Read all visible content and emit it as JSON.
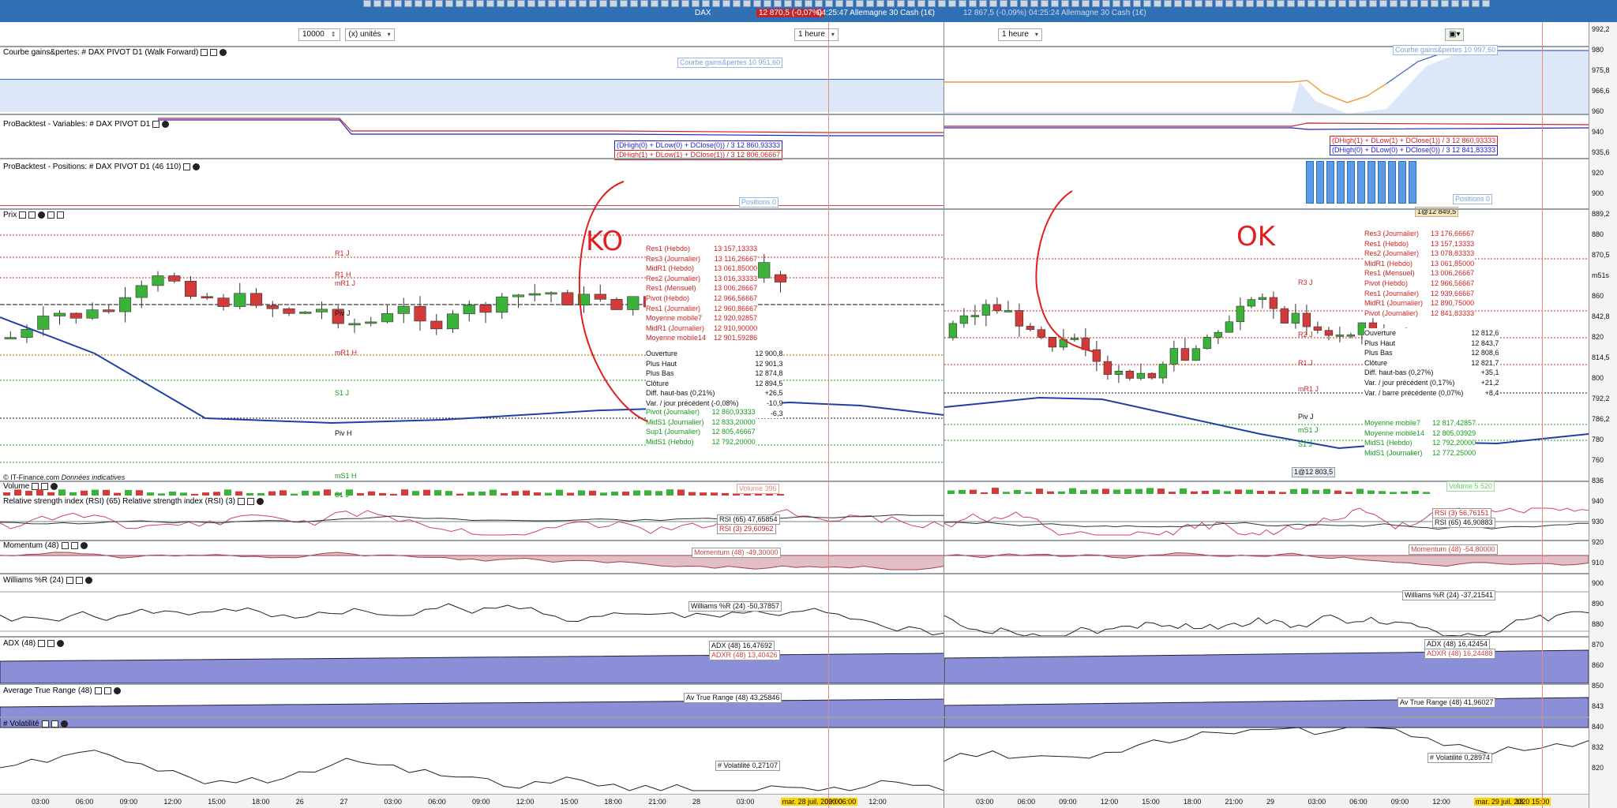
{
  "topbar": {
    "symbol": "DAX",
    "price_badge": "12 870,5 (-0,07%)",
    "time": "04:25:47 Allemagne 30 Cash (1€)",
    "right_info": "12 867,5 (-0,09%) 04:25:24 Allemagne 30 Cash (1€)"
  },
  "left": {
    "quantity": "10000",
    "units": "(x) unités",
    "timeframe": "1 heure",
    "titles": {
      "equity": "Courbe gains&pertes: # DAX PIVOT D1 (Walk Forward)",
      "vars": "ProBacktest - Variables: # DAX PIVOT D1",
      "positions": "ProBacktest - Positions: # DAX PIVOT D1 (46 110)",
      "price": "Prix",
      "volume": "Volume",
      "rsi": "Relative strength index (RSI) (65) Relative strength index (RSI) (3)",
      "momentum": "Momentum (48)",
      "williams": "Williams %R (24)",
      "adx": "ADX (48)",
      "atr": "Average True Range (48)",
      "vol": "# Volatilité"
    },
    "equity_tag": "Courbe gains&pertes 10 951,60",
    "var_tags": [
      "(DHigh(0) + DLow(0) + DClose(0)) / 3 12 860,93333",
      "(DHigh(1) + DLow(1) + DClose(1)) / 3 12 806,06667"
    ],
    "positions_tag": "Positions 0",
    "levels": [
      {
        "t": "R1 J",
        "c": "r"
      },
      {
        "t": "R1 H",
        "c": "r"
      },
      {
        "t": "mR1 J",
        "c": "r"
      },
      {
        "t": "Piv J",
        "c": "k"
      },
      {
        "t": "mR1 H",
        "c": "r"
      },
      {
        "t": "S1 J",
        "c": "g"
      },
      {
        "t": "Piv H",
        "c": "k"
      },
      {
        "t": "mS1 H",
        "c": "g"
      },
      {
        "t": "S1 J",
        "c": "g"
      }
    ],
    "legend_top": [
      [
        "Res1 (Hebdo)",
        "13 157,13333"
      ],
      [
        "Res3 (Journalier)",
        "13 116,26667"
      ],
      [
        "MidR1 (Hebdo)",
        "13 061,85000"
      ],
      [
        "Res2 (Journalier)",
        "13 016,33333"
      ],
      [
        "Res1 (Mensuel)",
        "13 006,26667"
      ],
      [
        "Pivot (Hebdo)",
        "12 966,56667"
      ],
      [
        "Res1 (Journalier)",
        "12 960,86667"
      ],
      [
        "Moyenne mobile7",
        "12 920,92857"
      ],
      [
        "MidR1 (Journalier)",
        "12 910,90000"
      ],
      [
        "Moyenne mobile14",
        "12 901,59286"
      ]
    ],
    "ohlc": [
      [
        "Ouverture",
        "12 900,8"
      ],
      [
        "Plus Haut",
        "12 901,3"
      ],
      [
        "Plus Bas",
        "12 874,8"
      ],
      [
        "Clôture",
        "12 894,5"
      ],
      [
        "Diff. haut-bas (0,21%)",
        "+26,5"
      ],
      [
        "Var. / jour précédent (-0,08%)",
        "-10,9"
      ],
      [
        "Var. / barre précédente (-0,05%)",
        "-6,3"
      ]
    ],
    "legend_bot": [
      [
        "Pivot (Journalier)",
        "12 860,93333"
      ],
      [
        "MidS1 (Journalier)",
        "12 833,20000"
      ],
      [
        "Sup1 (Journalier)",
        "12 805,46667"
      ],
      [
        "MidS1 (Hebdo)",
        "12 792,20000"
      ]
    ],
    "copyright": "© IT-Finance.com",
    "indicative": "Données indicatives",
    "volume_tag": "Volume 396",
    "rsi_tags": [
      "RSI (65) 47,65854",
      "RSI (3) 29,60962"
    ],
    "momentum_tag": "Momentum (48) -49,30000",
    "williams_tag": "Williams %R (24) -50,37857",
    "adx_tags": [
      "ADX (48) 16,47692",
      "ADXR (48) 13,40426"
    ],
    "atr_tag": "Av True Range (48) 43,25846",
    "vol_tag": "# Volatilité 0,27107",
    "xlabels": [
      "03:00",
      "06:00",
      "09:00",
      "12:00",
      "15:00",
      "18:00",
      "26",
      "27",
      "03:00",
      "06:00",
      "09:00",
      "12:00",
      "15:00",
      "18:00",
      "21:00",
      "28",
      "03:00",
      "mar. 28 juil. 2020 06:00",
      "09:00",
      "12:00"
    ],
    "annotation": "KO"
  },
  "right": {
    "timeframe": "1 heure",
    "equity_tag": "Courbe gains&pertes 10 997,60",
    "var_tags": [
      "(DHigh(1) + DLow(1) + DClose(1)) / 3 12 860,93333",
      "(DHigh(0) + DLow(0) + DClose(0)) / 3 12 841,83333"
    ],
    "positions_tag": "Positions 0",
    "entry_tag": "1@12 849,5",
    "exit_tag": "1@12 803,5",
    "levels": [
      {
        "t": "R3 J",
        "c": "r"
      },
      {
        "t": "R2 J",
        "c": "r"
      },
      {
        "t": "R1 J",
        "c": "r"
      },
      {
        "t": "mR1 J",
        "c": "r"
      },
      {
        "t": "Piv J",
        "c": "k"
      },
      {
        "t": "mS1 J",
        "c": "g"
      },
      {
        "t": "S1 J",
        "c": "g"
      }
    ],
    "legend_top": [
      [
        "Res3 (Journalier)",
        "13 176,66667"
      ],
      [
        "Res1 (Hebdo)",
        "13 157,13333"
      ],
      [
        "Res2 (Journalier)",
        "13 078,83333"
      ],
      [
        "MidR1 (Hebdo)",
        "13 061,85000"
      ],
      [
        "Res1 (Mensuel)",
        "13 006,26667"
      ],
      [
        "Pivot (Hebdo)",
        "12 966,56667"
      ],
      [
        "Res1 (Journalier)",
        "12 939,66667"
      ],
      [
        "MidR1 (Journalier)",
        "12 890,75000"
      ],
      [
        "Pivot (Journalier)",
        "12 841,83333"
      ]
    ],
    "ohlc": [
      [
        "Ouverture",
        "12 812,6"
      ],
      [
        "Plus Haut",
        "12 843,7"
      ],
      [
        "Plus Bas",
        "12 808,6"
      ],
      [
        "Clôture",
        "12 821,7"
      ],
      [
        "Diff. haut-bas (0,27%)",
        "+35,1"
      ],
      [
        "Var. / jour précédent (0,17%)",
        "+21,2"
      ],
      [
        "Var. / barre précédente (0,07%)",
        "+8,4"
      ]
    ],
    "legend_bot": [
      [
        "Moyenne mobile7",
        "12 817,42857"
      ],
      [
        "Moyenne mobile14",
        "12 805,03929"
      ],
      [
        "MidS1 (Hebdo)",
        "12 792,20000"
      ],
      [
        "MidS1 (Journalier)",
        "12 772,25000"
      ]
    ],
    "volume_tag": "Volume 5 520",
    "rsi_tags": [
      "RSI (3) 56,76151",
      "RSI (65) 46,90883"
    ],
    "momentum_tag": "Momentum (48) -54,80000",
    "williams_tag": "Williams %R (24) -37,21541",
    "adx_tags": [
      "ADX (48) 16,42454",
      "ADXR (48) 16,24488"
    ],
    "atr_tag": "Av True Range (48) 41,96027",
    "vol_tag": "# Volatilité 0,28974",
    "xlabels": [
      "03:00",
      "06:00",
      "09:00",
      "12:00",
      "15:00",
      "18:00",
      "21:00",
      "29",
      "03:00",
      "06:00",
      "09:00",
      "12:00",
      "mar. 29 juil. 2020 15:00",
      "18"
    ],
    "annotation": "OK"
  },
  "axis_labels": [
    "992,2",
    "980",
    "975,8",
    "966,6",
    "960",
    "940",
    "935,6",
    "920",
    "900",
    "889,2",
    "880",
    "870,5",
    "m51s",
    "860",
    "842,8",
    "820",
    "814,5",
    "800",
    "792,2",
    "786,2",
    "780",
    "760",
    "836",
    "940",
    "930",
    "920",
    "910",
    "900",
    "890",
    "880",
    "870",
    "860",
    "850",
    "843",
    "840",
    "832",
    "820"
  ],
  "colors": {
    "titlebar": "#2f6fb3",
    "up": "#3bb33b",
    "down": "#d33a3a",
    "ma": "#1f3fa6",
    "resistance": "#d22",
    "support": "#1a9a20",
    "annotation": "#e02020"
  }
}
